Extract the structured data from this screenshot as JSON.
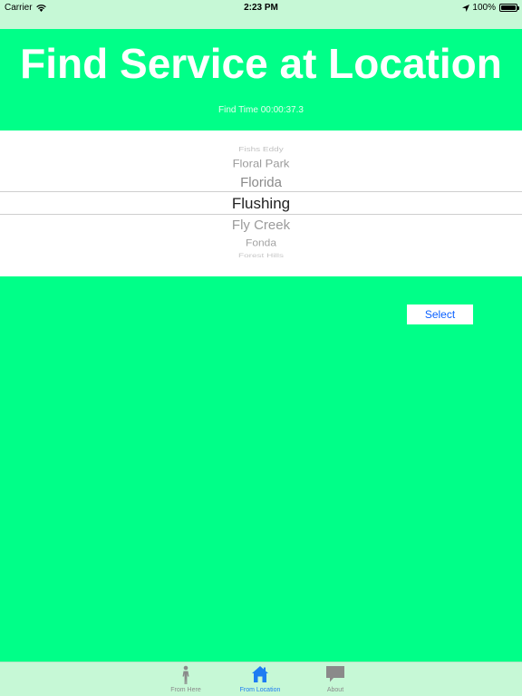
{
  "status_bar": {
    "carrier": "Carrier",
    "time": "2:23 PM",
    "battery_percent": "100%"
  },
  "header": {
    "title": "Find Service at Location",
    "find_time": "Find Time 00:00:37.3"
  },
  "picker": {
    "items": [
      "",
      "Fishs Eddy",
      "Floral Park",
      "Florida",
      "Flushing",
      "Fly Creek",
      "Fonda",
      "Forest Hills",
      ""
    ],
    "selected": "Flushing"
  },
  "select_button": {
    "label": "Select"
  },
  "tab_bar": {
    "tabs": [
      {
        "label": "From Here",
        "icon": "person-icon",
        "active": false
      },
      {
        "label": "From Location",
        "icon": "house-icon",
        "active": true
      },
      {
        "label": "About",
        "icon": "speech-bubble-icon",
        "active": false
      }
    ]
  },
  "colors": {
    "background": "#00ff88",
    "bars": "#c6f8d6",
    "accent": "#1e7cf2"
  }
}
